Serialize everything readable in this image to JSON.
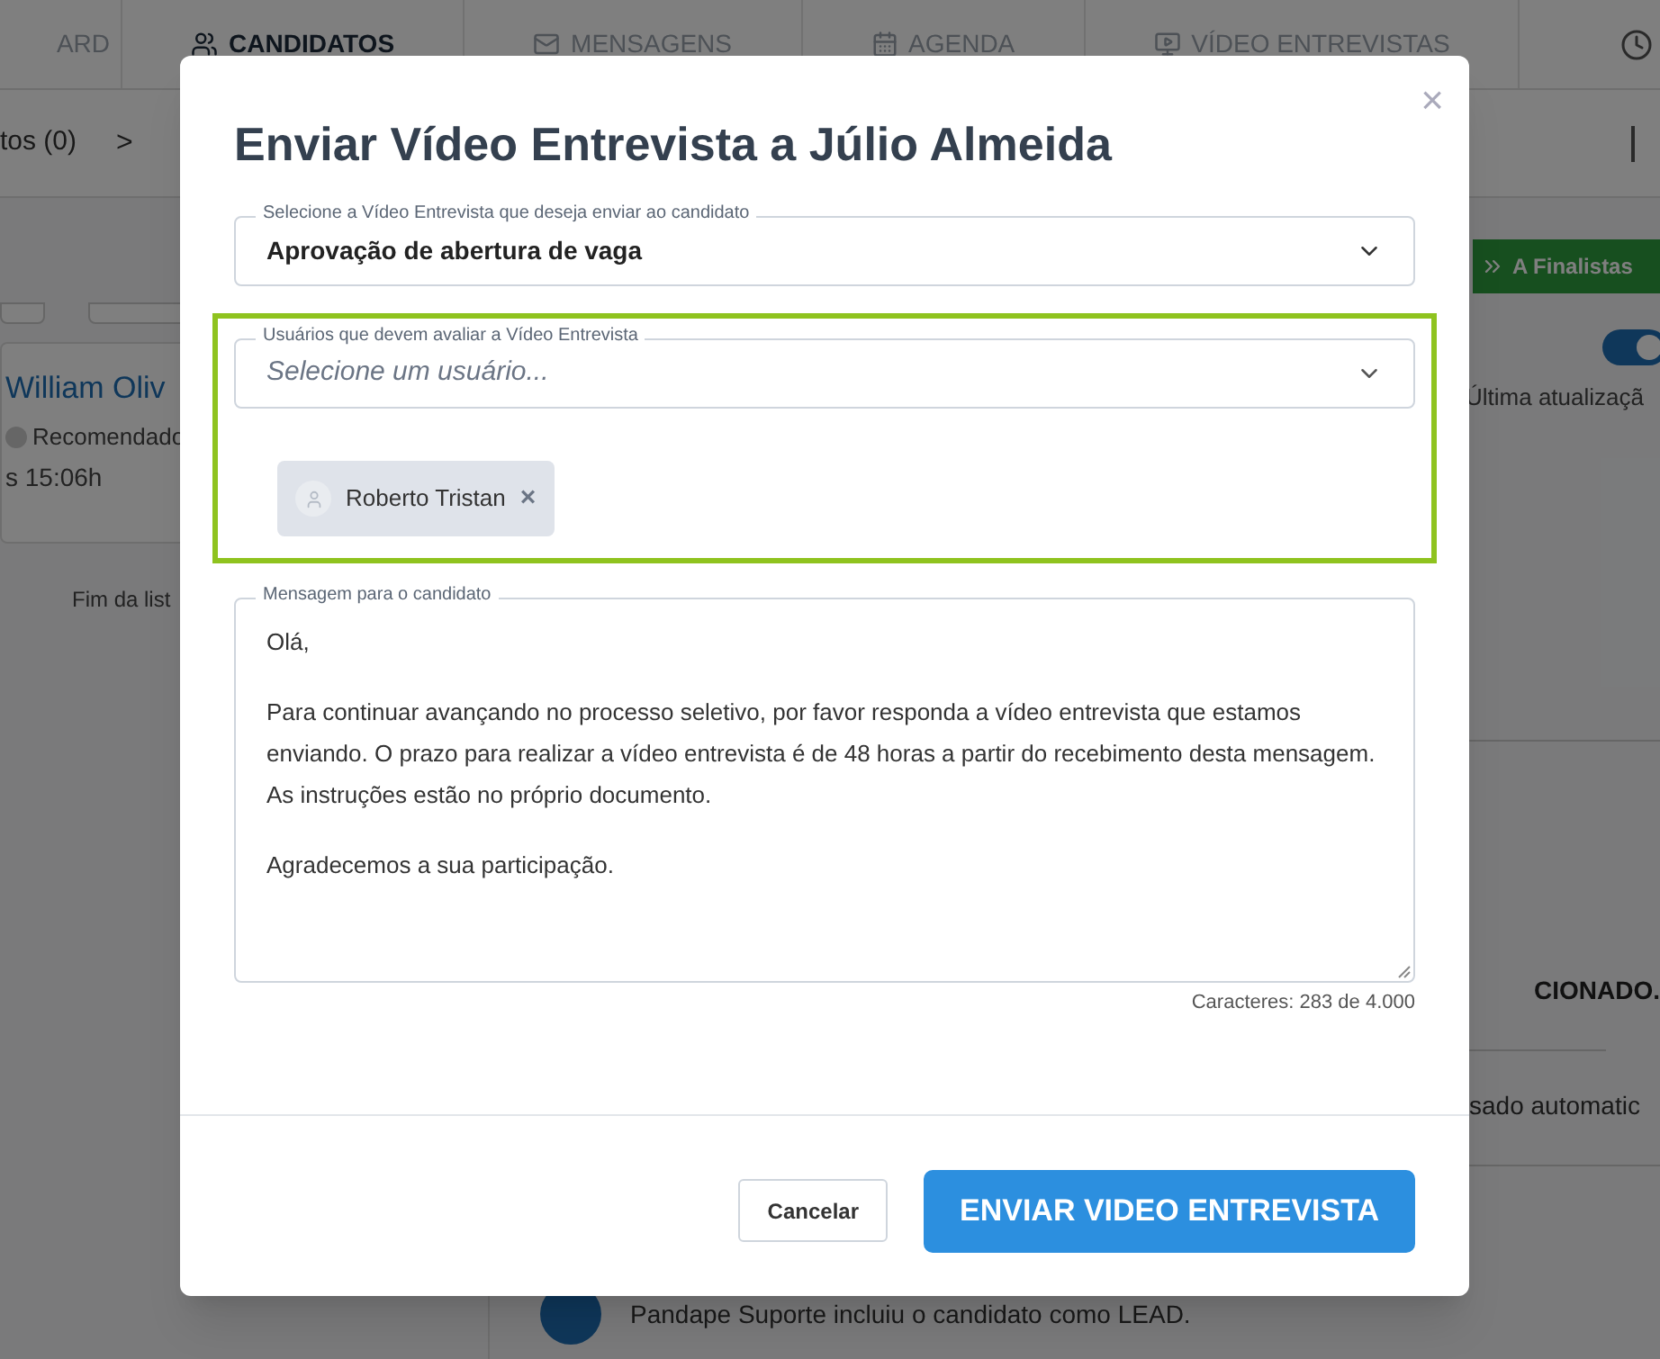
{
  "nav": {
    "tabs": [
      {
        "label": "ARD",
        "selected": false
      },
      {
        "label": "CANDIDATOS",
        "selected": true
      },
      {
        "label": "MENSAGENS",
        "selected": false
      },
      {
        "label": "AGENDA",
        "selected": false
      },
      {
        "label": "VÍDEO ENTREVISTAS",
        "selected": false
      }
    ]
  },
  "breadcrumb": {
    "item": "tos (0)",
    "separator": ">"
  },
  "candidate_card": {
    "name": "William Oliv",
    "tag": "Recomendado",
    "time": "s 15:06h"
  },
  "list_end": "Fim da list",
  "right_panel": {
    "stage_button": "A Finalistas",
    "toggle": {
      "on": true
    },
    "updated": "Última atualizaçã",
    "status": "CIONADO.",
    "event": "sado automatic",
    "feed_item": "Pandape Suporte incluiu o candidato como LEAD."
  },
  "modal": {
    "title": "Enviar Vídeo Entrevista a Júlio Almeida",
    "close": "×",
    "interview_select": {
      "legend": "Selecione a Vídeo Entrevista que deseja enviar ao candidato",
      "value": "Aprovação de abertura de vaga"
    },
    "evaluators": {
      "highlighted": true,
      "legend": "Usuários que devem avaliar a Vídeo Entrevista",
      "placeholder": "Selecione um usuário...",
      "chips": [
        {
          "label": "Roberto Tristan",
          "remove": "×"
        }
      ]
    },
    "message": {
      "legend": "Mensagem para o candidato",
      "paragraphs": [
        {
          "lines": [
            "Olá,"
          ]
        },
        {
          "lines": [
            "Para continuar avançando no processo seletivo, por favor responda a vídeo entrevista que estamos enviando. O prazo para realizar a vídeo entrevista é de 48 horas a partir do recebimento desta mensagem.",
            "As instruções estão no próprio documento."
          ]
        },
        {
          "lines": [
            "Agradecemos a sua participação."
          ]
        }
      ],
      "counter": "Caracteres: 283 de 4.000"
    },
    "buttons": [
      {
        "label": "Cancelar",
        "kind": "secondary"
      },
      {
        "label": "ENVIAR VIDEO ENTREVISTA",
        "kind": "primary"
      }
    ]
  }
}
